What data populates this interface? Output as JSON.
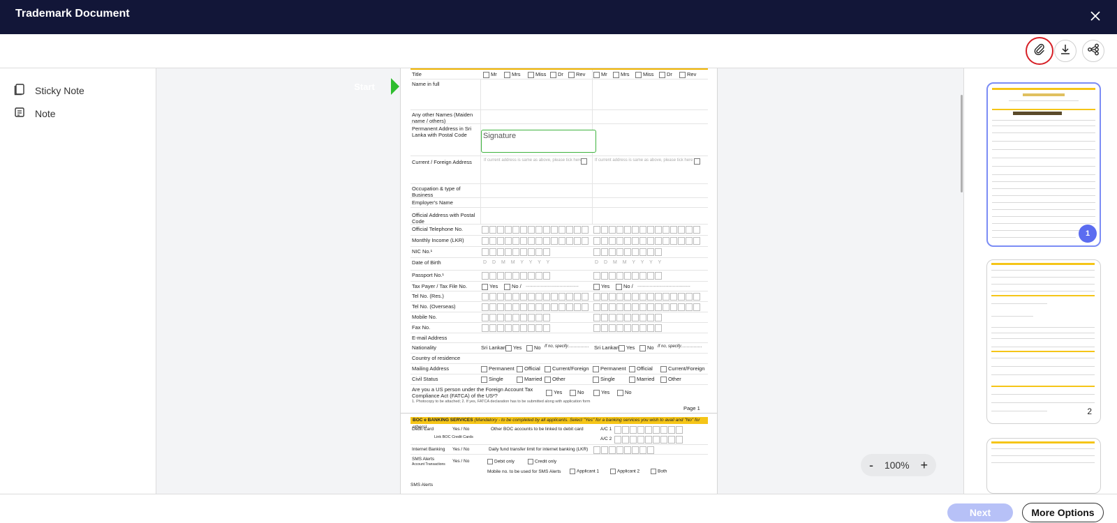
{
  "window": {
    "title": "Trademark Document"
  },
  "icons": {
    "close": "close-icon",
    "attach": "paperclip-icon",
    "download": "download-icon",
    "share": "share-icon",
    "sticky": "sticky-note-icon",
    "note": "note-icon"
  },
  "colors": {
    "titlebar": "#121638",
    "start": "#2ebd2e",
    "accent": "#5b6cf0",
    "attach_ring": "#d61f26",
    "next_disabled": "#b7c1f7"
  },
  "sidebar": {
    "items": [
      {
        "label": "Sticky Note"
      },
      {
        "label": "Note"
      }
    ]
  },
  "document": {
    "start_label": "Start",
    "signature_label": "Signature",
    "title_opts": [
      "Mr",
      "Mrs",
      "Miss",
      "Dr",
      "Rev"
    ],
    "rows": {
      "title": "Title",
      "name": "Name in full",
      "other_names": "Any other Names (Maiden name / others)",
      "perm_address": "Permanent Address in Sri Lanka with Postal Code",
      "current_address": "Current / Foreign Address",
      "current_hint": "If current address is same as above, please tick here",
      "occupation": "Occupation & type of Business",
      "employer": "Employer's Name",
      "official_address": "Official Address with Postal Code",
      "official_tel": "Official Telephone No.",
      "income": "Monthly Income (LKR)",
      "nic": "NIC No.¹",
      "dob": "Date of Birth",
      "dob_mask": "D D M M Y Y Y Y",
      "passport": "Passport No.¹",
      "taxpayer": "Tax Payer / Tax File No.",
      "yes": "Yes",
      "no_slash": "No /",
      "tel_res": "Tel No. (Res.)",
      "tel_overseas": "Tel No. (Overseas)",
      "mobile": "Mobile No.",
      "fax": "Fax No.",
      "email": "E-mail Address",
      "nationality": "Nationality",
      "sri_lankan": "Sri Lankan",
      "no": "No",
      "if_no": "If no, specify……………",
      "country": "Country of residence",
      "mailing": "Mailing Address",
      "permanent": "Permanent",
      "official": "Official",
      "current_foreign": "Current/Foreign",
      "civil": "Civil Status",
      "single": "Single",
      "married": "Married",
      "other": "Other",
      "fatca": "Are you a US person under the Foreign Account Tax Compliance Act (FATCA) of the US²?"
    },
    "footnote": "1. Photocopy to be attached;  2. If yes, FATCA declaration has to be submitted along with application form",
    "page_label": "Page 1",
    "p2": {
      "header_bold": "BOC e BANKING SERVICES",
      "header_rest": " (Mandatory - to be completed by all applicants. Select \"Yes\" for a banking services you wish to avail and \"No\" for others)",
      "debit": "Debit Card",
      "yes_no": "Yes / No",
      "other_boc": "Other BOC accounts to be linked to debit card",
      "ac1": "A/C 1",
      "ac2": "A/C 2",
      "link_credit": "Link BOC Credit Cards",
      "internet": "Internet Banking",
      "daily_limit": "Daily fund transfer limit for internet banking (LKR)",
      "sms": "SMS Alerts",
      "acct_tx": "Account Transactions",
      "debit_only": "Debit only",
      "credit_only": "Credit only",
      "mobile_sms": "Mobile no. to be used for SMS Alerts",
      "applicant1": "Applicant 1",
      "applicant2": "Applicant 2",
      "both": "Both",
      "sms_alerts_cut": "SMS Alerts"
    }
  },
  "zoom": {
    "minus": "-",
    "level": "100%",
    "plus": "+"
  },
  "thumbnails": [
    {
      "page": "1"
    },
    {
      "page": "2"
    }
  ],
  "footer": {
    "next": "Next",
    "more": "More Options"
  }
}
